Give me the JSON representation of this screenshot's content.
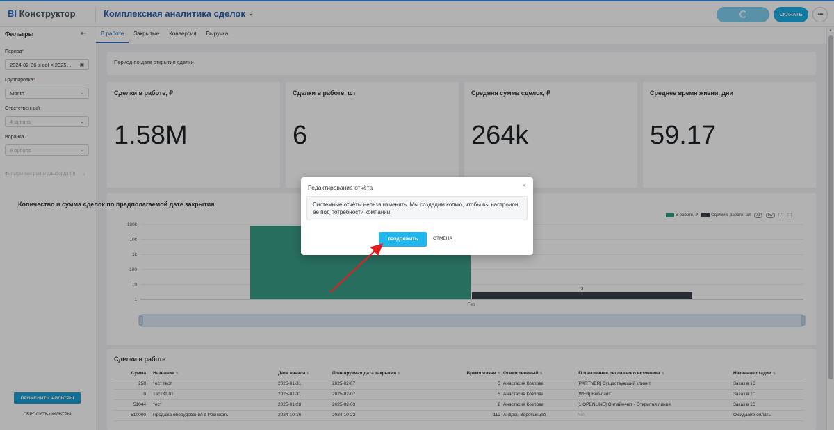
{
  "header": {
    "logo_bi": "BI",
    "logo_text": "Конструктор",
    "report_title": "Комплексная аналитика сделок",
    "download_label": "СКАЧАТЬ",
    "more_label": "•••"
  },
  "sidebar": {
    "title": "Фильтры",
    "filters": {
      "period_label": "Период",
      "period_value": "2024-02-06 ≤ col < 2025…",
      "grouping_label": "Группировка",
      "grouping_value": "Month",
      "responsible_label": "Ответственный",
      "responsible_placeholder": "4 options",
      "funnel_label": "Воронка",
      "funnel_placeholder": "8 options"
    },
    "hint": "Фильтры вне рамок дашборда (0)",
    "apply_label": "ПРИМЕНИТЬ ФИЛЬТРЫ",
    "reset_label": "СБРОСИТЬ ФИЛЬТРЫ"
  },
  "tabs": [
    "В работе",
    "Закрытые",
    "Конверсия",
    "Выручка"
  ],
  "period_note": "Период по дате открытия сделки",
  "kpis": [
    {
      "title": "Сделки в работе, ₽",
      "value": "1.58M"
    },
    {
      "title": "Сделки в работе, шт",
      "value": "6"
    },
    {
      "title": "Средняя сумма сделок, ₽",
      "value": "264k"
    },
    {
      "title": "Среднее время жизни, дни",
      "value": "59.17"
    }
  ],
  "chart": {
    "title": "Количество и сумма сделок по предполагаемой дате закрытия",
    "legend": [
      "В работе, ₽",
      "Сделки в работе, шт"
    ],
    "legend_chips": [
      "All",
      "Inv"
    ],
    "colors": {
      "sum": "#3a9e89",
      "count": "#3c434d"
    }
  },
  "chart_data": {
    "type": "bar",
    "categories": [
      "Feb"
    ],
    "series": [
      {
        "name": "В работе, ₽",
        "values": [
          80000
        ]
      },
      {
        "name": "Сделки в работе, шт",
        "values": [
          3
        ]
      }
    ],
    "yscale": "log",
    "ylim": [
      1,
      100000
    ],
    "yticks": [
      "1",
      "10",
      "100",
      "1k",
      "10k",
      "100k"
    ],
    "data_labels": [
      "3"
    ]
  },
  "table": {
    "title": "Сделки в работе",
    "columns": [
      "Сумма",
      "Название",
      "Дата начала",
      "Планируемая дата закрытия",
      "Время жизни",
      "Ответственный",
      "ID и название рекламного источника",
      "Название стадии"
    ],
    "rows": [
      [
        "250",
        "тест тест",
        "2025-01-31",
        "2025-02-07",
        "5",
        "Анастасия Козлова",
        "[PARTNER] Существующий клиент",
        "Заказ в 1С"
      ],
      [
        "0",
        "Тест31.01",
        "2025-01-31",
        "2025-02-07",
        "5",
        "Анастасия Козлова",
        "[WEB] Веб-сайт",
        "Заказ в 1С"
      ],
      [
        "51044",
        "тест",
        "2025-01-28",
        "2025-02-03",
        "8",
        "Анастасия Козлова",
        "[1|OPENLINE] Онлайн-чат - Открытая линия",
        "Заказ в 1С"
      ],
      [
        "510000",
        "Продажа оборудования в Роснефть",
        "2024-10-16",
        "2024-10-23",
        "112",
        "Андрей Воротынцев",
        "N/A",
        "Ожидание оплаты"
      ]
    ]
  },
  "modal": {
    "title": "Редактирование отчёта",
    "message": "Системные отчёты нельзя изменять. Мы создадим копию, чтобы вы настроили её под потребности компании",
    "continue_label": "ПРОДОЛЖИТЬ",
    "cancel_label": "ОТМЕНА",
    "close_label": "×"
  }
}
